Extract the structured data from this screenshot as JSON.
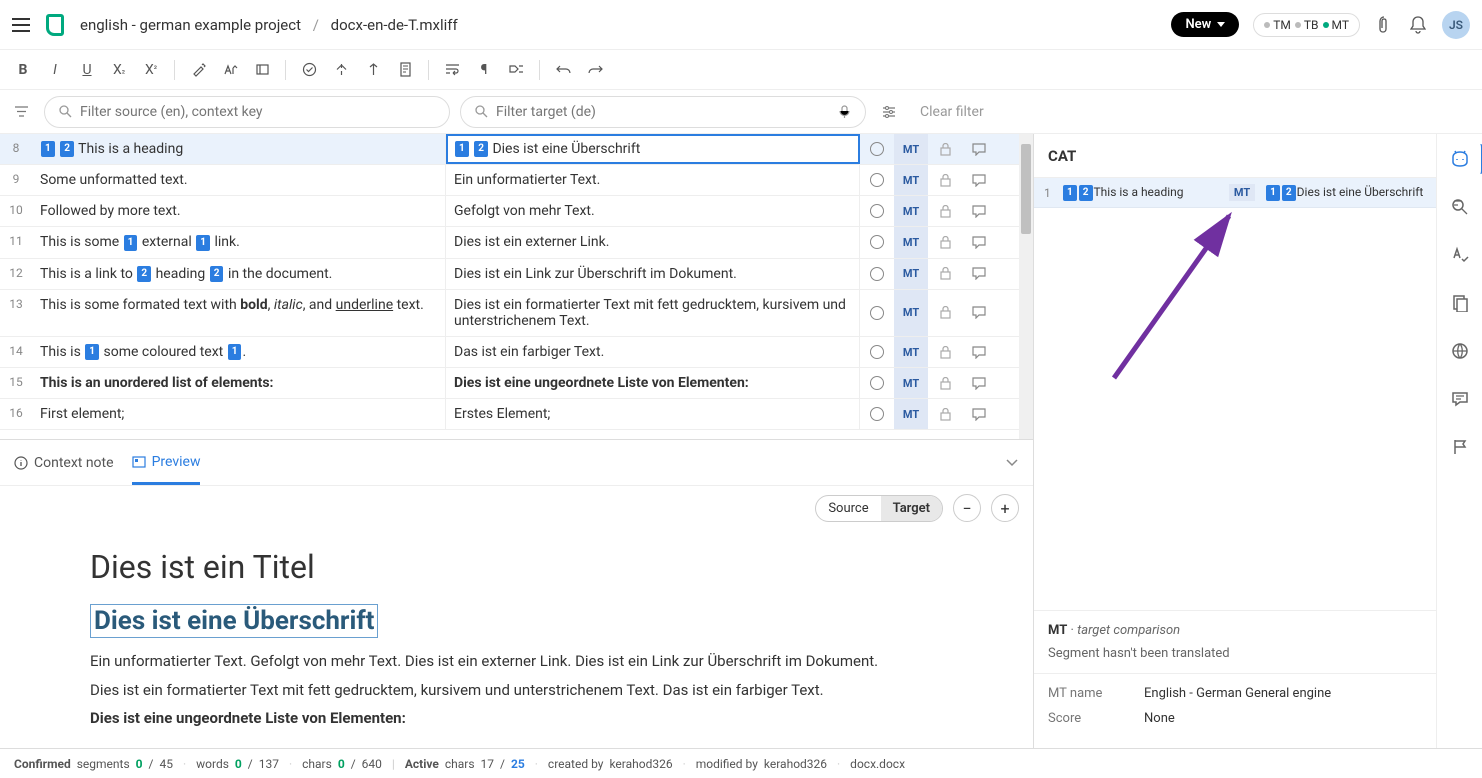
{
  "breadcrumb": {
    "project": "english - german example project",
    "file": "docx-en-de-T.mxliff"
  },
  "topbar": {
    "new": "New",
    "tm": "TM",
    "tb": "TB",
    "mt": "MT",
    "avatar": "JS"
  },
  "filters": {
    "src_placeholder": "Filter source (en), context key",
    "tgt_placeholder": "Filter target (de)",
    "clear": "Clear filter"
  },
  "rows": [
    {
      "n": "8",
      "srcTags": [
        "1",
        "2"
      ],
      "src": "This is a heading",
      "tgtTags": [
        "1",
        "2"
      ],
      "tgt": "Dies ist eine Überschrift",
      "sel": true
    },
    {
      "n": "9",
      "src": "Some unformatted text.",
      "tgt": "Ein unformatierter Text."
    },
    {
      "n": "10",
      "src": "Followed by more text.",
      "tgt": "Gefolgt von mehr Text."
    },
    {
      "n": "11",
      "srcHtml": "This is some <span class=tag>1</span> external <span class=tag>1</span> link.",
      "tgt": "Dies ist ein externer Link."
    },
    {
      "n": "12",
      "srcHtml": "This is a link to <span class=tag>2</span> heading <span class=tag>2</span> in the document.",
      "tgt": "Dies ist ein Link zur Überschrift im Dokument."
    },
    {
      "n": "13",
      "srcHtml": "This is some formated text with <b>bold</b>, <i>italic</i>, and <u>underline</u> text.",
      "tgt": "Dies ist ein formatierter Text mit fett gedrucktem, kursivem und unterstrichenem Text."
    },
    {
      "n": "14",
      "srcHtml": "This is <span class=tag>1</span> some coloured text <span class=tag>1</span>.",
      "tgt": "Das ist ein farbiger Text."
    },
    {
      "n": "15",
      "srcHtml": "<b>This is an unordered list of elements:</b>",
      "tgtHtml": "<b>Dies ist eine ungeordnete Liste von Elementen:</b>"
    },
    {
      "n": "16",
      "src": "First element;",
      "tgt": "Erstes Element;"
    }
  ],
  "tabs": {
    "context": "Context note",
    "preview": "Preview"
  },
  "previewCtrl": {
    "source": "Source",
    "target": "Target"
  },
  "preview": {
    "title": "Dies ist ein Titel",
    "h2": "Dies ist eine Überschrift",
    "p1": "Ein unformatierter Text. Gefolgt von mehr Text. Dies ist ein externer Link. Dies ist ein Link zur Überschrift im Dokument.",
    "p2": "Dies ist ein formatierter Text mit fett gedrucktem, kursivem und unterstrichenem Text. Das ist ein farbiger Text.",
    "p3": "Dies ist eine ungeordnete Liste von Elementen:"
  },
  "cat": {
    "title": "CAT",
    "row": {
      "n": "1",
      "src": "This is a heading",
      "badge": "MT",
      "tgt": "Dies ist eine Überschrift"
    },
    "footer": {
      "mt": "MT",
      "label": "target comparison",
      "msg": "Segment hasn't been translated"
    },
    "meta": {
      "name_l": "MT name",
      "name_v": "English - German General engine",
      "score_l": "Score",
      "score_v": "None"
    }
  },
  "status": {
    "confirmed": "Confirmed",
    "segments": "segments",
    "seg_a": "0",
    "seg_b": "45",
    "words": "words",
    "w_a": "0",
    "w_b": "137",
    "chars": "chars",
    "c_a": "0",
    "c_b": "640",
    "active": "Active",
    "a_chars": "chars",
    "ac_a": "17",
    "ac_b": "25",
    "created": "created by",
    "creator": "kerahod326",
    "modified": "modified by",
    "modifier": "kerahod326",
    "doc": "docx.docx"
  }
}
